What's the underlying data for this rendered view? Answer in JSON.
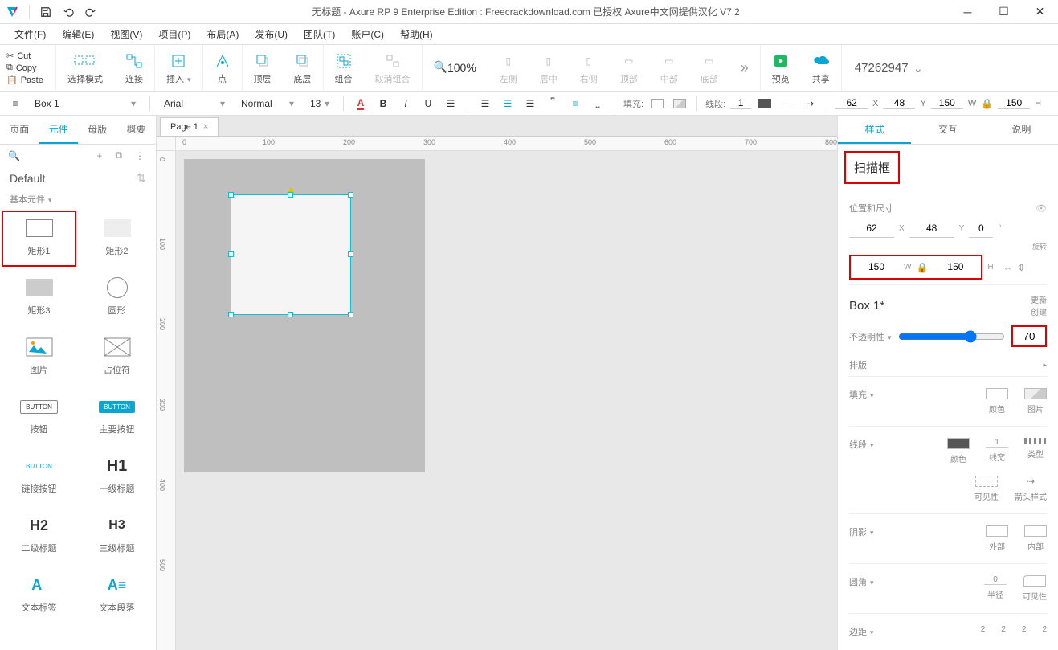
{
  "window": {
    "title": "无标题 - Axure RP 9 Enterprise Edition : Freecrackdownload.com 已授权    Axure中文网提供汉化 V7.2"
  },
  "menus": [
    "文件(F)",
    "编辑(E)",
    "视图(V)",
    "项目(P)",
    "布局(A)",
    "发布(U)",
    "团队(T)",
    "账户(C)",
    "帮助(H)"
  ],
  "clipboard": {
    "cut": "Cut",
    "copy": "Copy",
    "paste": "Paste"
  },
  "ribbon": {
    "select_mode": "选择模式",
    "connect": "连接",
    "insert": "插入",
    "point": "点",
    "top": "顶层",
    "bottom": "底层",
    "group": "组合",
    "ungroup": "取消组合",
    "zoom": "100%",
    "align_left": "左侧",
    "align_center": "居中",
    "align_right": "右侧",
    "align_top": "顶部",
    "align_middle": "中部",
    "align_bottom": "底部",
    "preview": "预览",
    "share": "共享",
    "user": "47262947"
  },
  "propbar": {
    "style": "Box 1",
    "font": "Arial",
    "weight": "Normal",
    "size": "13",
    "fill_label": "填充:",
    "line_label": "线段:",
    "line_w": "1",
    "x": "62",
    "y": "48",
    "w": "150",
    "h": "150"
  },
  "left": {
    "tabs": [
      "页面",
      "元件",
      "母版",
      "概要"
    ],
    "active_tab": 1,
    "default": "Default",
    "section": "基本元件",
    "widgets": [
      {
        "label": "矩形1"
      },
      {
        "label": "矩形2"
      },
      {
        "label": "矩形3"
      },
      {
        "label": "圆形"
      },
      {
        "label": "图片"
      },
      {
        "label": "占位符"
      },
      {
        "label": "按钮"
      },
      {
        "label": "主要按钮"
      },
      {
        "label": "链接按钮"
      },
      {
        "label": "一级标题"
      },
      {
        "label": "二级标题"
      },
      {
        "label": "三级标题"
      },
      {
        "label": "文本标签"
      },
      {
        "label": "文本段落"
      }
    ]
  },
  "canvas": {
    "tab": "Page 1",
    "ruler_h": [
      "0",
      "100",
      "200",
      "300",
      "400",
      "500",
      "600",
      "700",
      "800"
    ],
    "ruler_v": [
      "0",
      "100",
      "200",
      "300",
      "400",
      "500"
    ]
  },
  "right": {
    "tabs": [
      "样式",
      "交互",
      "说明"
    ],
    "active_tab": 0,
    "obj_name": "扫描框",
    "pos_section": "位置和尺寸",
    "x": "62",
    "y": "48",
    "rot": "0",
    "rot_label": "旋转",
    "w": "150",
    "h": "150",
    "style_name": "Box 1*",
    "update_create": "更新\n创建",
    "opacity_label": "不透明性",
    "opacity": "70",
    "layout": "排版",
    "fill": "填充",
    "color": "颜色",
    "image": "图片",
    "line": "线段",
    "width": "线宽",
    "line_w": "1",
    "type": "类型",
    "visibility": "可见性",
    "arrow": "箭头样式",
    "shadow": "阴影",
    "outer": "外部",
    "inner": "内部",
    "corner": "圆角",
    "radius": "半径",
    "radius_v": "0",
    "padding": "边距",
    "pad_v": "2"
  }
}
